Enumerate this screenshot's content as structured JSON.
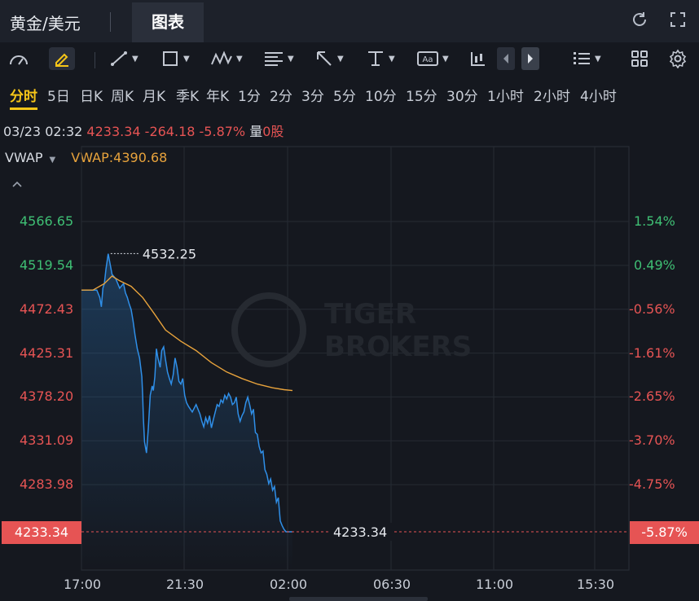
{
  "header": {
    "title": "黄金/美元",
    "tab_label": "图表"
  },
  "periods": [
    "分时",
    "5日",
    "日K",
    "周K",
    "月K",
    "季K",
    "年K",
    "1分",
    "2分",
    "3分",
    "5分",
    "10分",
    "15分",
    "30分",
    "1小时",
    "2小时",
    "4小时"
  ],
  "active_period": "分时",
  "info": {
    "datetime": "03/23 02:32",
    "price": "4233.34",
    "change": "-264.18",
    "change_pct": "-5.87%",
    "volume_label": "量",
    "volume": "0股"
  },
  "indicator": {
    "name": "VWAP",
    "value_label": "VWAP:4390.68"
  },
  "watermark": {
    "line1": "TIGER",
    "line2": "BROKERS"
  },
  "colors": {
    "up": "#3fbf74",
    "down": "#e65454",
    "price_line": "#2f8fe8",
    "vwap_line": "#e8a33c",
    "accent": "#f5c518"
  },
  "chart_data": {
    "type": "line",
    "y_labels": [
      "4566.65",
      "4519.54",
      "4472.43",
      "4425.31",
      "4378.20",
      "4331.09",
      "4283.98"
    ],
    "pct_labels": [
      "1.54%",
      "0.49%",
      "-0.56%",
      "-1.61%",
      "-2.65%",
      "-3.70%",
      "-4.75%"
    ],
    "x_labels": [
      "17:00",
      "21:30",
      "02:00",
      "06:30",
      "11:00",
      "15:30"
    ],
    "ylim": [
      4233.34,
      4566.65
    ],
    "current_price_label": "4233.34",
    "current_pct_label": "-5.87%",
    "high_label": "4532.25",
    "series": [
      {
        "name": "price",
        "x_minutes": [
          0,
          30,
          40,
          48,
          52,
          56,
          60,
          64,
          70,
          80,
          90,
          100,
          110,
          115,
          120,
          125,
          130,
          135,
          140,
          146,
          152,
          158,
          160,
          162,
          165,
          170,
          175,
          180,
          185,
          188,
          192,
          196,
          200,
          206,
          210,
          215,
          220,
          225,
          230,
          235,
          240,
          245,
          250,
          255,
          260,
          265,
          270,
          275,
          280,
          290,
          300,
          310,
          315,
          320,
          325,
          330,
          335,
          340,
          345,
          350,
          355,
          360,
          365,
          370,
          375,
          380,
          385,
          390,
          395,
          400,
          405,
          410,
          415,
          420,
          425,
          430,
          435,
          440,
          445,
          450,
          455,
          460,
          465,
          470,
          475,
          480,
          485,
          490,
          495,
          500,
          505,
          510,
          515,
          520,
          525,
          530,
          535,
          540,
          542,
          545,
          548,
          550,
          552
        ],
        "values": [
          4493,
          4493,
          4493,
          4485,
          4475,
          4495,
          4500,
          4515,
          4532,
          4510,
          4505,
          4495,
          4500,
          4490,
          4485,
          4478,
          4472,
          4460,
          4445,
          4430,
          4420,
          4400,
          4380,
          4355,
          4330,
          4318,
          4345,
          4380,
          4390,
          4385,
          4400,
          4430,
          4420,
          4410,
          4428,
          4432,
          4418,
          4405,
          4398,
          4392,
          4402,
          4420,
          4410,
          4395,
          4392,
          4398,
          4380,
          4372,
          4368,
          4362,
          4370,
          4360,
          4352,
          4346,
          4356,
          4350,
          4358,
          4345,
          4354,
          4362,
          4370,
          4368,
          4375,
          4372,
          4380,
          4376,
          4382,
          4378,
          4370,
          4372,
          4378,
          4360,
          4352,
          4358,
          4362,
          4372,
          4378,
          4370,
          4360,
          4365,
          4340,
          4338,
          4325,
          4318,
          4320,
          4300,
          4295,
          4285,
          4290,
          4278,
          4282,
          4265,
          4270,
          4245,
          4240,
          4236,
          4233.34,
          4233.34,
          4233.34,
          4233.34,
          4233.34,
          4233.34,
          4233.34
        ]
      },
      {
        "name": "VWAP",
        "x_minutes": [
          0,
          30,
          60,
          80,
          100,
          130,
          160,
          190,
          220,
          260,
          300,
          340,
          380,
          420,
          460,
          500,
          530,
          552
        ],
        "values": [
          4493,
          4493,
          4500,
          4508,
          4503,
          4497,
          4485,
          4468,
          4450,
          4438,
          4428,
          4415,
          4405,
          4398,
          4392,
          4388,
          4386,
          4385
        ]
      }
    ]
  }
}
